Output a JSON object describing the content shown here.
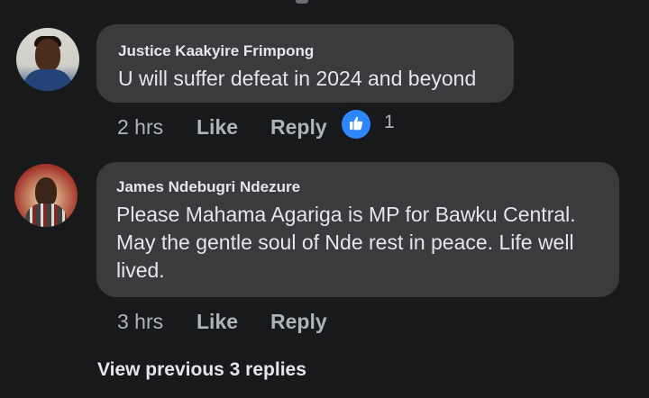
{
  "comments": [
    {
      "author": "Justice Kaakyire Frimpong",
      "text": "U will suffer defeat in 2024 and beyond",
      "time": "2 hrs",
      "like_label": "Like",
      "reply_label": "Reply",
      "reaction_icon": "thumbs-up-icon",
      "reaction_count": "1"
    },
    {
      "author": "James Ndebugri Ndezure",
      "text": "Please Mahama Agariga is MP for Bawku Central.\nMay the gentle soul of Nde rest in peace. Life well\nlived.",
      "time": "3 hrs",
      "like_label": "Like",
      "reply_label": "Reply"
    }
  ],
  "view_previous_label": "View previous 3 replies",
  "colors": {
    "background": "#18191a",
    "bubble": "#3a3b3c",
    "primary_text": "#e4e6eb",
    "secondary_text": "#b0b3b8",
    "reaction_blue": "#2d88ff"
  }
}
